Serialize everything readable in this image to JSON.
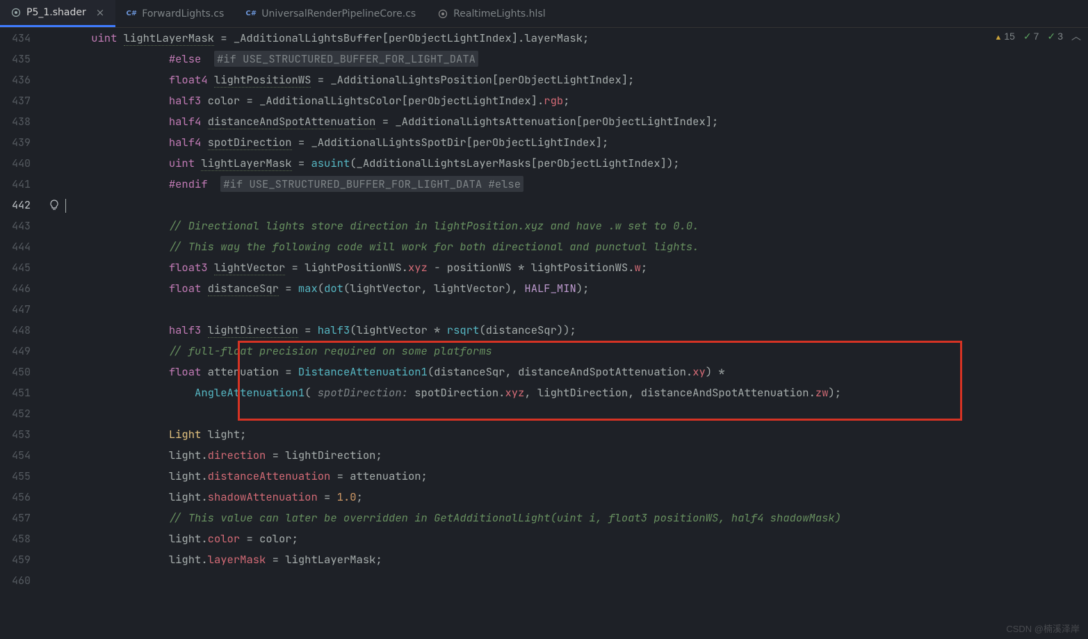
{
  "tabs": [
    {
      "label": "P5_1.shader",
      "icon": "shader",
      "active": true,
      "closeable": true
    },
    {
      "label": "ForwardLights.cs",
      "icon": "cs",
      "active": false
    },
    {
      "label": "UniversalRenderPipelineCore.cs",
      "icon": "cs",
      "active": false
    },
    {
      "label": "RealtimeLights.hlsl",
      "icon": "shader",
      "active": false
    }
  ],
  "status": {
    "warnings": "15",
    "checks_green": "7",
    "checks_double": "3"
  },
  "line_numbers": [
    "434",
    "435",
    "436",
    "437",
    "438",
    "439",
    "440",
    "441",
    "442",
    "443",
    "444",
    "445",
    "446",
    "447",
    "448",
    "449",
    "450",
    "451",
    "452",
    "453",
    "454",
    "455",
    "456",
    "457",
    "458",
    "459",
    "460"
  ],
  "current_line_index": 8,
  "code": {
    "l434": {
      "type": "uint",
      "ident": "lightLayerMask",
      "rhs": "_AdditionalLightsBuffer[perObjectLightIndex].layerMask;"
    },
    "l435": {
      "pp": "#else",
      "hint": "#if USE_STRUCTURED_BUFFER_FOR_LIGHT_DATA"
    },
    "l436": {
      "type": "float4",
      "ident": "lightPositionWS",
      "rhs": "_AdditionalLightsPosition[perObjectLightIndex];"
    },
    "l437": {
      "type": "half3",
      "ident_txt": "color",
      "rhs_pre": "_AdditionalLightsColor[perObjectLightIndex]",
      "mem": "rgb"
    },
    "l438": {
      "type": "half4",
      "ident": "distanceAndSpotAttenuation",
      "rhs": "_AdditionalLightsAttenuation[perObjectLightIndex];"
    },
    "l439": {
      "type": "half4",
      "ident": "spotDirection",
      "rhs": "_AdditionalLightsSpotDir[perObjectLightIndex];"
    },
    "l440": {
      "type": "uint",
      "ident": "lightLayerMask",
      "fn": "asuint",
      "args": "(_AdditionalLightsLayerMasks[perObjectLightIndex]);"
    },
    "l441": {
      "pp": "#endif",
      "hint": "#if USE_STRUCTURED_BUFFER_FOR_LIGHT_DATA #else"
    },
    "l443": "// Directional lights store direction in lightPosition.xyz and have .w set to 0.0.",
    "l444": "// This way the following code will work for both directional and punctual lights.",
    "l445": {
      "type": "float3",
      "ident": "lightVector",
      "segA": "lightPositionWS",
      "memA": "xyz",
      "mid": " - positionWS * lightPositionWS",
      "memB": "w"
    },
    "l446": {
      "type": "float",
      "ident": "distanceSqr",
      "fn1": "max",
      "fn2": "dot",
      "args1": "(lightVector, lightVector)",
      "const": "HALF_MIN"
    },
    "l448": {
      "type": "half3",
      "ident": "lightDirection",
      "fn1": "half3",
      "args1": "(lightVector * ",
      "fn2": "rsqrt",
      "args2": "(distanceSqr));"
    },
    "l449": "// full-float precision required on some platforms",
    "l450": {
      "type": "float",
      "ident_txt": "attenuation",
      "fn": "DistanceAttenuation1",
      "segA": "(distanceSqr, distanceAndSpotAttenuation",
      "memA": "xy",
      "tail": ") *"
    },
    "l451": {
      "fn": "AngleAttenuation1",
      "param": " spotDirection: ",
      "segA": "spotDirection",
      "memA": "xyz",
      "mid": ", lightDirection, distanceAndSpotAttenuation",
      "memB": "zw",
      "tail": ");"
    },
    "l453": {
      "type": "Light",
      "ident_txt": "light;"
    },
    "l454": {
      "obj": "light",
      "mem": "direction",
      "rhs": "lightDirection;"
    },
    "l455": {
      "obj": "light",
      "mem": "distanceAttenuation",
      "rhs": "attenuation;"
    },
    "l456": {
      "obj": "light",
      "mem": "shadowAttenuation",
      "num": "1.0"
    },
    "l457": "// This value can later be overridden in GetAdditionalLight(uint i, float3 positionWS, half4 shadowMask)",
    "l458": {
      "obj": "light",
      "mem": "color",
      "rhs": "color;"
    },
    "l459": {
      "obj": "light",
      "mem": "layerMask",
      "rhs": "lightLayerMask;"
    }
  },
  "watermark": "CSDN @楠溪泽岸"
}
